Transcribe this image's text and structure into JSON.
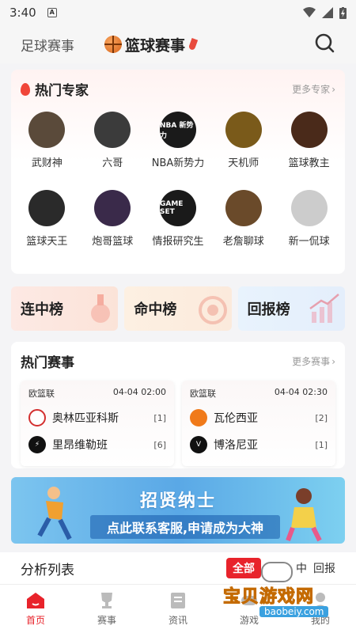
{
  "status_bar": {
    "time": "3:40",
    "badge": "A"
  },
  "top_nav": {
    "tabs": [
      {
        "label": "足球赛事"
      },
      {
        "label": "篮球赛事"
      }
    ]
  },
  "experts": {
    "title": "热门专家",
    "more": "更多专家",
    "items": [
      {
        "name": "武财神",
        "avatar_bg": "#5a4a3a"
      },
      {
        "name": "六哥",
        "avatar_bg": "#3b3b3b"
      },
      {
        "name": "NBA新势力",
        "avatar_bg": "#1a1a1a",
        "avatar_text": "NBA 新势力"
      },
      {
        "name": "天机师",
        "avatar_bg": "#7a5a1a"
      },
      {
        "name": "篮球教主",
        "avatar_bg": "#4a2a1a"
      },
      {
        "name": "篮球天王",
        "avatar_bg": "#2a2a2a"
      },
      {
        "name": "炮哥篮球",
        "avatar_bg": "#3a2a4a"
      },
      {
        "name": "情报研究生",
        "avatar_bg": "#1a1a1a",
        "avatar_text": "GAME SET"
      },
      {
        "name": "老詹聊球",
        "avatar_bg": "#6a4a2a"
      },
      {
        "name": "新一侃球",
        "avatar_bg": "#cccccc"
      }
    ]
  },
  "rankings": [
    {
      "label": "连中榜"
    },
    {
      "label": "命中榜"
    },
    {
      "label": "回报榜"
    }
  ],
  "hot_matches": {
    "title": "热门赛事",
    "more": "更多赛事",
    "matches": [
      {
        "league": "欧篮联",
        "time": "04-04 02:00",
        "home": {
          "name": "奥林匹亚科斯",
          "score": "[1]",
          "logo_color": "#d32f2f"
        },
        "away": {
          "name": "里昂维勒班",
          "score": "[6]",
          "logo_color": "#111111"
        }
      },
      {
        "league": "欧篮联",
        "time": "04-04 02:30",
        "home": {
          "name": "瓦伦西亚",
          "score": "[2]",
          "logo_color": "#f07a1a"
        },
        "away": {
          "name": "博洛尼亚",
          "score": "[1]",
          "logo_color": "#111111"
        }
      }
    ]
  },
  "banner": {
    "title": "招贤纳士",
    "subtitle": "点此联系客服,申请成为大神"
  },
  "analysis": {
    "title": "分析列表",
    "filters": [
      {
        "label": "全部"
      },
      {
        "label": "连中"
      },
      {
        "label": "中"
      },
      {
        "label": "回报"
      }
    ]
  },
  "tab_bar": {
    "items": [
      {
        "label": "首页"
      },
      {
        "label": "赛事"
      },
      {
        "label": "资讯"
      },
      {
        "label": "游戏"
      },
      {
        "label": "我的"
      }
    ]
  },
  "watermark": {
    "text": "宝贝游戏网",
    "url": "baobeiy.com"
  },
  "colors": {
    "accent": "#e8232b",
    "page_bg": "#f4f4f6"
  }
}
